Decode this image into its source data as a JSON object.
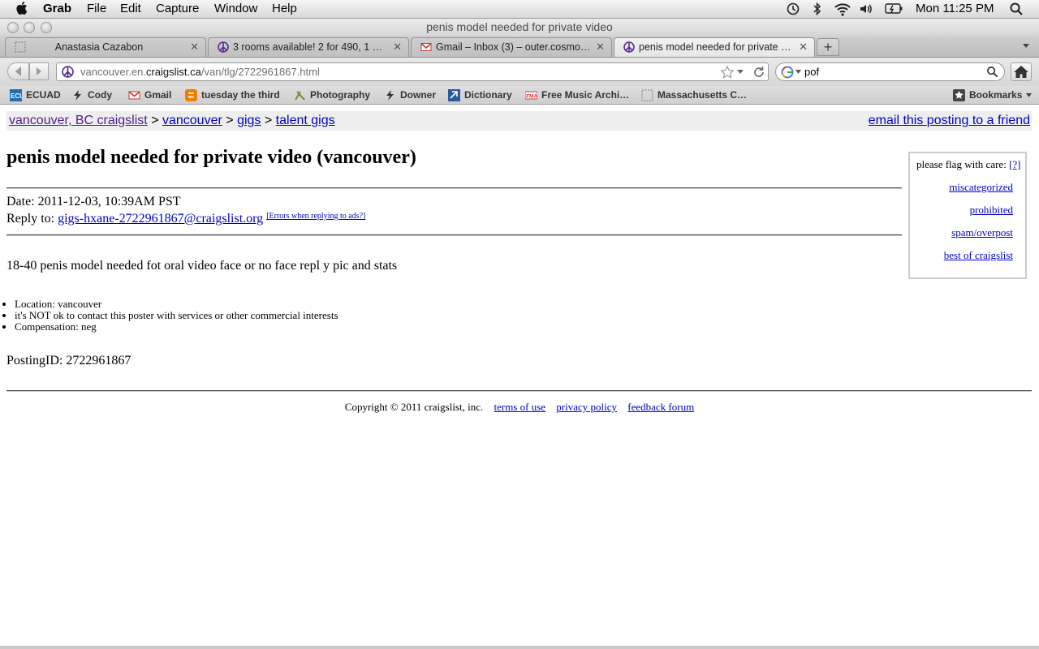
{
  "menubar": {
    "app_name": "Grab",
    "menus": [
      "File",
      "Edit",
      "Capture",
      "Window",
      "Help"
    ],
    "clock": "Mon 11:25 PM"
  },
  "window": {
    "title": "penis model needed for private video"
  },
  "tabs": [
    {
      "label": "Anastasia Cazabon",
      "icon": "blank-page-icon",
      "active": false
    },
    {
      "label": "3 rooms available! 2 for 490, 1 …",
      "icon": "peace-icon",
      "active": false
    },
    {
      "label": "Gmail – Inbox (3) – outer.cosmo…",
      "icon": "gmail-icon",
      "active": false
    },
    {
      "label": "penis model needed for private …",
      "icon": "peace-icon",
      "active": true
    }
  ],
  "toolbar": {
    "url_prefix": "vancouver.en.",
    "url_domain": "craigslist.ca",
    "url_path": "/van/tlg/2722961867.html",
    "search_value": "pof"
  },
  "bookmarks": {
    "items": [
      {
        "label": "ECUAD",
        "icon": "ecuad-icon"
      },
      {
        "label": "Cody",
        "icon": "bolt-icon"
      },
      {
        "label": "Gmail",
        "icon": "gmail-icon"
      },
      {
        "label": "tuesday the third",
        "icon": "blogger-icon"
      },
      {
        "label": "Photography",
        "icon": "photo-icon"
      },
      {
        "label": "Downer",
        "icon": "bolt-icon"
      },
      {
        "label": "Dictionary",
        "icon": "dictionary-icon"
      },
      {
        "label": "Free Music Archi…",
        "icon": "fma-icon"
      },
      {
        "label": "Massachusetts C…",
        "icon": "blank-page-icon"
      }
    ],
    "menu_label": "Bookmarks"
  },
  "page": {
    "breadcrumb": {
      "site": "vancouver, BC craigslist",
      "sep": ">",
      "city": "vancouver",
      "section": "gigs",
      "category": "talent gigs"
    },
    "email_friend": "email this posting to a friend",
    "title": "penis model needed for private video (vancouver)",
    "date": "Date: 2011-12-03, 10:39AM PST",
    "reply_label": "Reply to:",
    "reply_email": "gigs-hxane-2722961867@craigslist.org",
    "reply_errors": "[Errors when replying to ads?]",
    "body": "18-40 penis model needed fot oral video face or no face repl y pic and stats",
    "details": [
      "Location: vancouver",
      "it's NOT ok to contact this poster with services or other commercial interests",
      "Compensation: neg"
    ],
    "posting_id": "PostingID: 2722961867",
    "footer": {
      "copyright": "Copyright © 2011 craigslist, inc.",
      "links": [
        "terms of use",
        "privacy policy",
        "feedback forum"
      ]
    },
    "flag_box": {
      "header": "please flag with care:",
      "help": "[?]",
      "options": [
        "miscategorized",
        "prohibited",
        "spam/overpost",
        "best of craigslist"
      ]
    }
  }
}
